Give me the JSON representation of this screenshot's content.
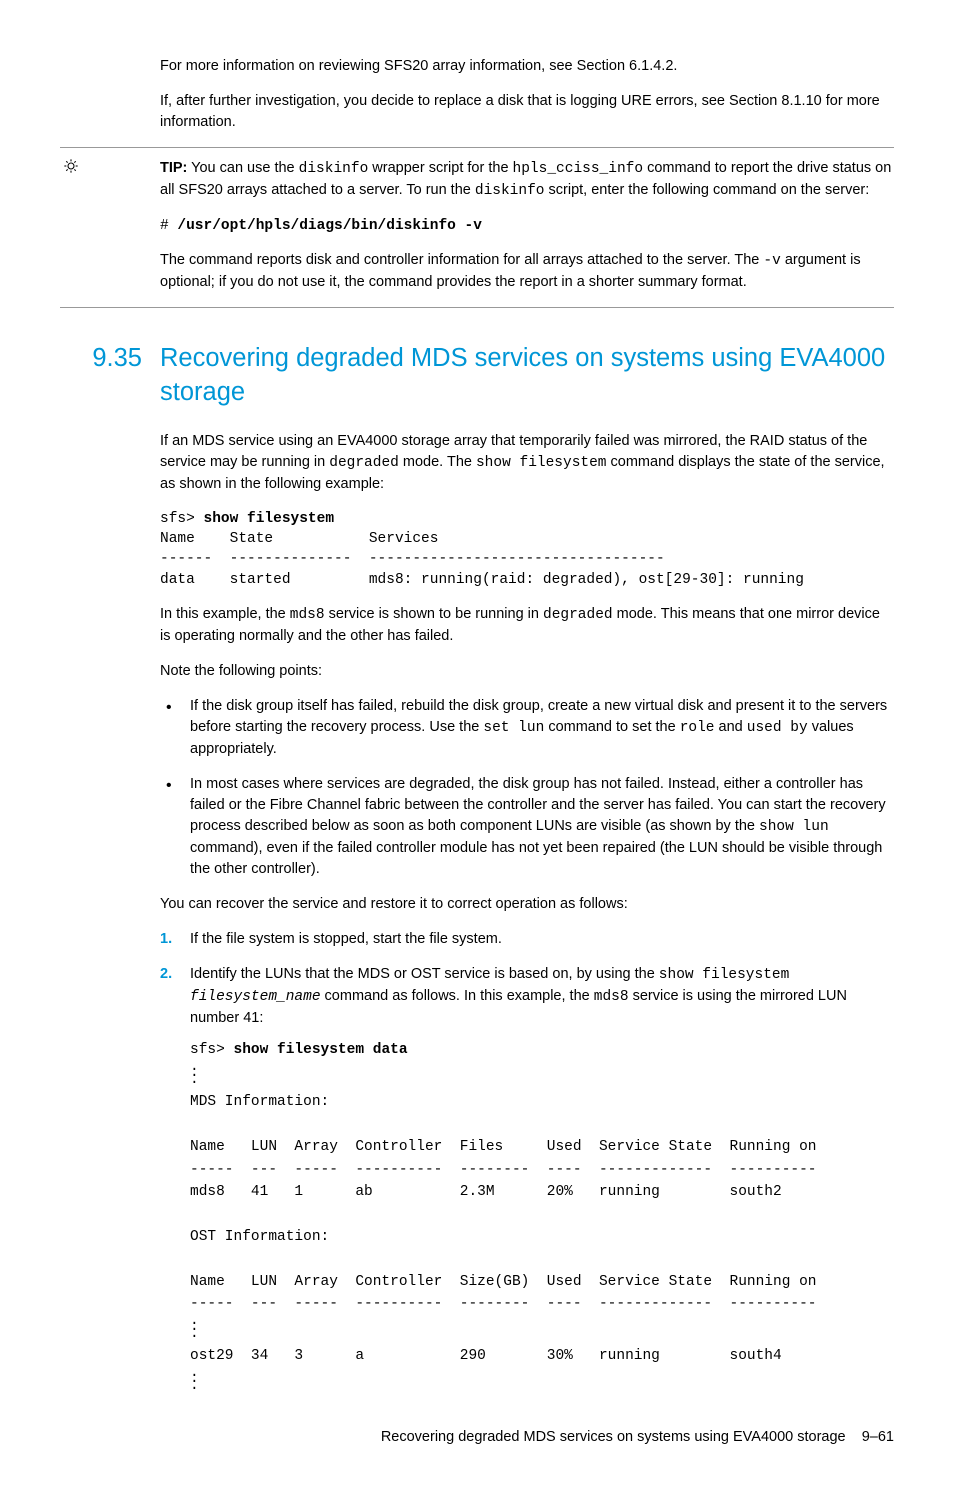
{
  "intro": {
    "p1": "For more information on reviewing SFS20 array information, see Section 6.1.4.2.",
    "p2a": "If, after further investigation, you decide to replace a disk that is logging URE errors, see Section 8.1.10 for more information."
  },
  "tip": {
    "label": "TIP:",
    "t1a": " You can use the ",
    "t1b": "diskinfo",
    "t1c": " wrapper script for the ",
    "t1d": "hpls_cciss_info",
    "t1e": " command to report the drive status on all SFS20 arrays attached to a server. To run the ",
    "t1f": "diskinfo",
    "t1g": " script, enter the following command on the server:",
    "cmd_prompt": "# ",
    "cmd": "/usr/opt/hpls/diags/bin/diskinfo -v",
    "t2a": "The command reports disk and controller information for all arrays attached to the server. The ",
    "t2b": "-v",
    "t2c": " argument is optional; if you do not use it, the command provides the report in a shorter summary format."
  },
  "section": {
    "num": "9.35",
    "title": "Recovering degraded MDS services on systems using EVA4000 storage",
    "p1a": "If an MDS service using an EVA4000 storage array that temporarily failed was mirrored, the RAID status of the service may be running in ",
    "p1b": "degraded",
    "p1c": " mode. The ",
    "p1d": "show filesystem",
    "p1e": " command displays the state of the service, as shown in the following example:",
    "code1_prompt": "sfs> ",
    "code1_cmd": "show filesystem",
    "code1_body": "Name    State           Services\n------  --------------  ----------------------------------\ndata    started         mds8: running(raid: degraded), ost[29-30]: running",
    "p2a": "In this example, the ",
    "p2b": "mds8",
    "p2c": " service is shown to be running in ",
    "p2d": "degraded",
    "p2e": " mode. This means that one mirror device is operating normally and the other has failed.",
    "p3": "Note the following points:",
    "b1a": "If the disk group itself has failed, rebuild the disk group, create a new virtual disk and present it to the servers before starting the recovery process. Use the ",
    "b1b": "set lun",
    "b1c": " command to set the ",
    "b1d": "role",
    "b1e": " and ",
    "b1f": "used by",
    "b1g": " values appropriately.",
    "b2a": "In most cases where services are degraded, the disk group has not failed. Instead, either a controller has failed or the Fibre Channel fabric between the controller and the server has failed. You can start the recovery process described below as soon as both component LUNs are visible (as shown by the ",
    "b2b": "show lun",
    "b2c": " command), even if the failed controller module has not yet been repaired (the LUN should be visible through the other controller).",
    "p4": "You can recover the service and restore it to correct operation as follows:",
    "s1": "If the file system is stopped, start the file system.",
    "s2a": "Identify the LUNs that the MDS or OST service is based on, by using the ",
    "s2b": "show filesystem ",
    "s2c": "filesystem_name",
    "s2d": " command as follows. In this example, the ",
    "s2e": "mds8",
    "s2f": " service is using the mirrored LUN number 41:",
    "code2_prompt": "sfs> ",
    "code2_cmd": "show filesystem data",
    "code2_body1": "MDS Information:\n\nName   LUN  Array  Controller  Files     Used  Service State  Running on\n-----  ---  -----  ----------  --------  ----  -------------  ----------\nmds8   41   1      ab          2.3M      20%   running        south2\n\nOST Information:\n\nName   LUN  Array  Controller  Size(GB)  Used  Service State  Running on\n-----  ---  -----  ----------  --------  ----  -------------  ----------",
    "code2_body2": "ost29  34   3      a           290       30%   running        south4"
  },
  "footer": {
    "title": "Recovering degraded MDS services on systems using EVA4000 storage",
    "page": "9–61"
  }
}
